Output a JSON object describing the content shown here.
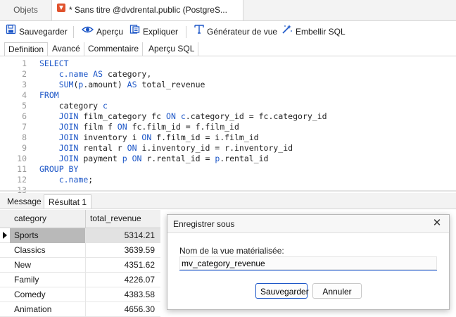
{
  "tabs": {
    "objets": "Objets",
    "query": "* Sans titre @dvdrental.public (PostgreS..."
  },
  "toolbar": {
    "save": "Sauvegarder",
    "preview": "Aperçu",
    "explain": "Expliquer",
    "view_generator": "Générateur de vue",
    "beautify": "Embellir SQL"
  },
  "subtabs": [
    "Definition",
    "Avancé",
    "Commentaire",
    "Aperçu SQL"
  ],
  "editor": {
    "lines": [
      {
        "n": "1",
        "indent": "",
        "tokens": [
          {
            "t": "SELECT",
            "k": true
          }
        ]
      },
      {
        "n": "2",
        "indent": "    ",
        "tokens": [
          {
            "t": "c.name ",
            "k": true
          },
          {
            "t": "AS",
            "k": true
          },
          {
            "t": " category,",
            "k": false
          }
        ]
      },
      {
        "n": "3",
        "indent": "    ",
        "tokens": [
          {
            "t": "SUM",
            "k": true
          },
          {
            "t": "(",
            "k": false
          },
          {
            "t": "p",
            "k": true
          },
          {
            "t": ".amount) ",
            "k": false
          },
          {
            "t": "AS",
            "k": true
          },
          {
            "t": " total_revenue",
            "k": false
          }
        ]
      },
      {
        "n": "4",
        "indent": "",
        "tokens": [
          {
            "t": "FROM",
            "k": true
          }
        ]
      },
      {
        "n": "5",
        "indent": "    ",
        "tokens": [
          {
            "t": "category ",
            "k": false
          },
          {
            "t": "c",
            "k": true
          }
        ]
      },
      {
        "n": "6",
        "indent": "    ",
        "tokens": [
          {
            "t": "JOIN",
            "k": true
          },
          {
            "t": " film_category fc ",
            "k": false
          },
          {
            "t": "ON",
            "k": true
          },
          {
            "t": " ",
            "k": false
          },
          {
            "t": "c",
            "k": true
          },
          {
            "t": ".category_id = fc.category_id",
            "k": false
          }
        ]
      },
      {
        "n": "7",
        "indent": "    ",
        "tokens": [
          {
            "t": "JOIN",
            "k": true
          },
          {
            "t": " film f ",
            "k": false
          },
          {
            "t": "ON",
            "k": true
          },
          {
            "t": " fc.film_id = f.film_id",
            "k": false
          }
        ]
      },
      {
        "n": "8",
        "indent": "    ",
        "tokens": [
          {
            "t": "JOIN",
            "k": true
          },
          {
            "t": " inventory i ",
            "k": false
          },
          {
            "t": "ON",
            "k": true
          },
          {
            "t": " f.film_id = i.film_id",
            "k": false
          }
        ]
      },
      {
        "n": "9",
        "indent": "    ",
        "tokens": [
          {
            "t": "JOIN",
            "k": true
          },
          {
            "t": " rental r ",
            "k": false
          },
          {
            "t": "ON",
            "k": true
          },
          {
            "t": " i.inventory_id = r.inventory_id",
            "k": false
          }
        ]
      },
      {
        "n": "10",
        "indent": "    ",
        "tokens": [
          {
            "t": "JOIN",
            "k": true
          },
          {
            "t": " payment ",
            "k": false
          },
          {
            "t": "p",
            "k": true
          },
          {
            "t": " ",
            "k": false
          },
          {
            "t": "ON",
            "k": true
          },
          {
            "t": " r.rental_id = ",
            "k": false
          },
          {
            "t": "p",
            "k": true
          },
          {
            "t": ".rental_id",
            "k": false
          }
        ]
      },
      {
        "n": "11",
        "indent": "",
        "tokens": [
          {
            "t": "GROUP BY",
            "k": true
          }
        ]
      },
      {
        "n": "12",
        "indent": "    ",
        "tokens": [
          {
            "t": "c.name",
            "k": true
          },
          {
            "t": ";",
            "k": false
          }
        ]
      },
      {
        "n": "13",
        "indent": "",
        "tokens": []
      }
    ]
  },
  "result_tabs": {
    "message": "Message",
    "result": "Résultat 1"
  },
  "grid": {
    "columns": [
      "category",
      "total_revenue"
    ],
    "rows": [
      {
        "category": "Sports",
        "total_revenue": "5314.21"
      },
      {
        "category": "Classics",
        "total_revenue": "3639.59"
      },
      {
        "category": "New",
        "total_revenue": "4351.62"
      },
      {
        "category": "Family",
        "total_revenue": "4226.07"
      },
      {
        "category": "Comedy",
        "total_revenue": "4383.58"
      },
      {
        "category": "Animation",
        "total_revenue": "4656.30"
      }
    ]
  },
  "dialog": {
    "title": "Enregistrer sous",
    "label": "Nom de la vue matérialisée:",
    "value": "mv_category_revenue",
    "save": "Sauvegarder",
    "cancel": "Annuler"
  },
  "colors": {
    "accent": "#1c56c7",
    "keyword": "#1c56c7",
    "query_icon": "#e0522d"
  }
}
